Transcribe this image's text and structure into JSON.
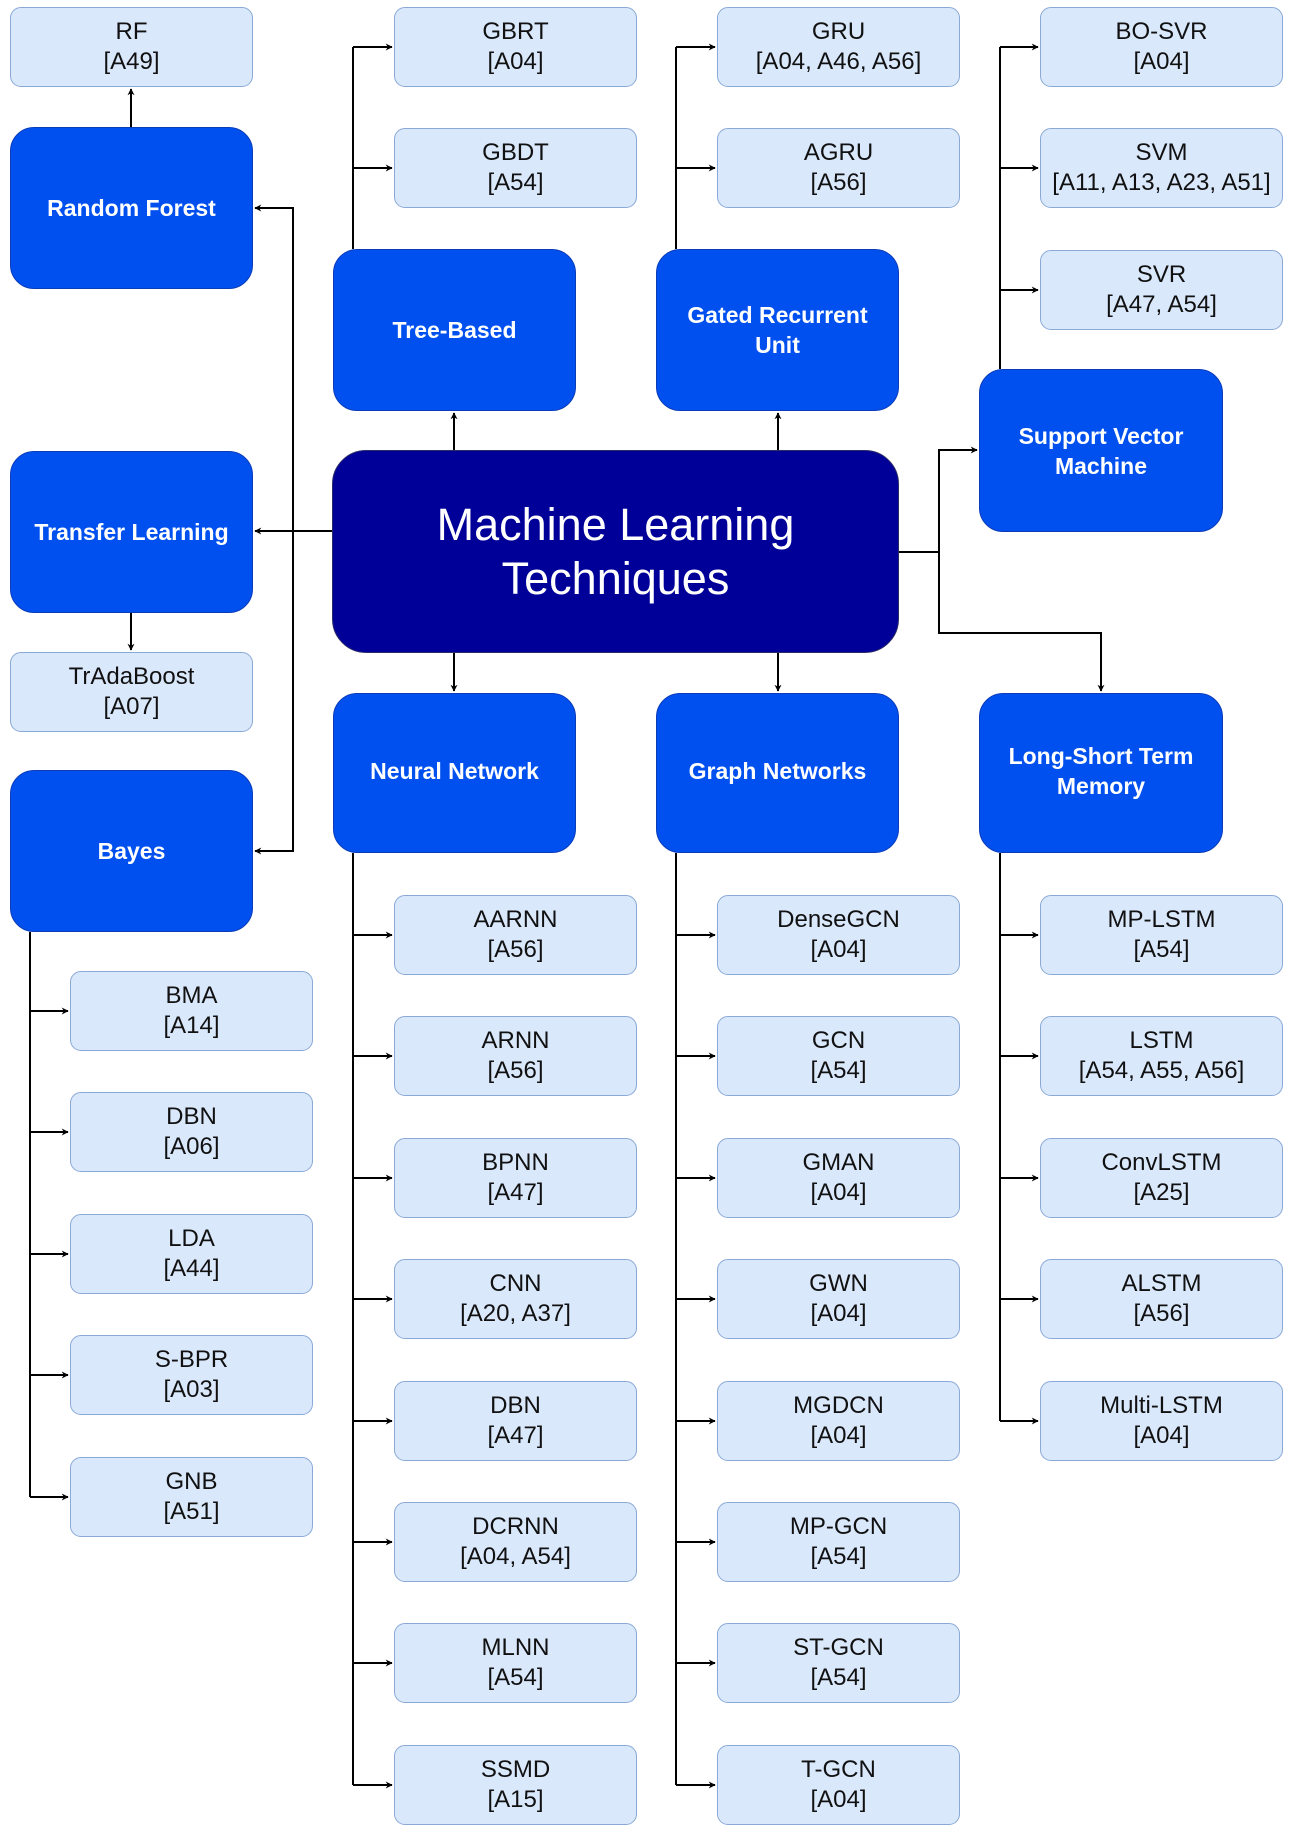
{
  "title": "Machine Learning Techniques",
  "colors": {
    "root_fill": "#000099",
    "category_fill": "#0050EF",
    "leaf_fill": "#DAE8FC",
    "leaf_stroke": "#6C8EBF",
    "connector": "#000000"
  },
  "root": {
    "label_line1": "Machine Learning",
    "label_line2": "Techniques"
  },
  "categories": {
    "random_forest": {
      "label": "Random Forest",
      "children": [
        {
          "name": "RF",
          "refs": "[A49]"
        }
      ]
    },
    "transfer_learning": {
      "label": "Transfer Learning",
      "children": [
        {
          "name": "TrAdaBoost",
          "refs": "[A07]"
        }
      ]
    },
    "bayes": {
      "label": "Bayes",
      "children": [
        {
          "name": "BMA",
          "refs": "[A14]"
        },
        {
          "name": "DBN",
          "refs": "[A06]"
        },
        {
          "name": "LDA",
          "refs": "[A44]"
        },
        {
          "name": "S-BPR",
          "refs": "[A03]"
        },
        {
          "name": "GNB",
          "refs": "[A51]"
        }
      ]
    },
    "tree_based": {
      "label": "Tree-Based",
      "children": [
        {
          "name": "GBRT",
          "refs": "[A04]"
        },
        {
          "name": "GBDT",
          "refs": "[A54]"
        }
      ]
    },
    "gru": {
      "label_line1": "Gated Recurrent",
      "label_line2": "Unit",
      "children": [
        {
          "name": "GRU",
          "refs": "[A04, A46, A56]"
        },
        {
          "name": "AGRU",
          "refs": "[A56]"
        }
      ]
    },
    "svm": {
      "label_line1": "Support Vector",
      "label_line2": "Machine",
      "children": [
        {
          "name": "BO-SVR",
          "refs": "[A04]"
        },
        {
          "name": "SVM",
          "refs": "[A11, A13, A23, A51]"
        },
        {
          "name": "SVR",
          "refs": "[A47, A54]"
        }
      ]
    },
    "neural_network": {
      "label": "Neural Network",
      "children": [
        {
          "name": "AARNN",
          "refs": "[A56]"
        },
        {
          "name": "ARNN",
          "refs": "[A56]"
        },
        {
          "name": "BPNN",
          "refs": "[A47]"
        },
        {
          "name": "CNN",
          "refs": "[A20, A37]"
        },
        {
          "name": "DBN",
          "refs": "[A47]"
        },
        {
          "name": "DCRNN",
          "refs": "[A04, A54]"
        },
        {
          "name": "MLNN",
          "refs": "[A54]"
        },
        {
          "name": "SSMD",
          "refs": "[A15]"
        }
      ]
    },
    "graph_networks": {
      "label": "Graph Networks",
      "children": [
        {
          "name": "DenseGCN",
          "refs": "[A04]"
        },
        {
          "name": "GCN",
          "refs": "[A54]"
        },
        {
          "name": "GMAN",
          "refs": "[A04]"
        },
        {
          "name": "GWN",
          "refs": "[A04]"
        },
        {
          "name": "MGDCN",
          "refs": "[A04]"
        },
        {
          "name": "MP-GCN",
          "refs": "[A54]"
        },
        {
          "name": "ST-GCN",
          "refs": "[A54]"
        },
        {
          "name": "T-GCN",
          "refs": "[A04]"
        }
      ]
    },
    "lstm": {
      "label_line1": "Long-Short Term",
      "label_line2": "Memory",
      "children": [
        {
          "name": "MP-LSTM",
          "refs": "[A54]"
        },
        {
          "name": "LSTM",
          "refs": "[A54, A55, A56]"
        },
        {
          "name": "ConvLSTM",
          "refs": "[A25]"
        },
        {
          "name": "ALSTM",
          "refs": "[A56]"
        },
        {
          "name": "Multi-LSTM",
          "refs": "[A04]"
        }
      ]
    }
  }
}
